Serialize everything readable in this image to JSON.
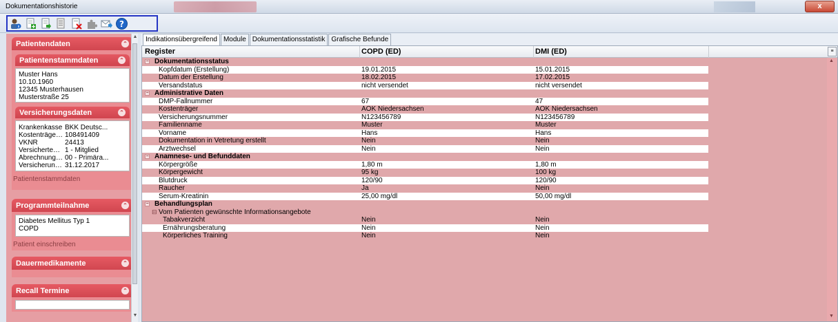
{
  "window": {
    "title": "Dokumentationshistorie",
    "close_glyph": "x"
  },
  "toolbar": {
    "icons": [
      "patient-info-icon",
      "document-add-icon",
      "document-export-icon",
      "document-list-icon",
      "document-delete-icon",
      "puzzle-icon",
      "mail-send-icon",
      "help-icon"
    ]
  },
  "sidebar": {
    "patientendaten": {
      "title": "Patientendaten",
      "stamm": {
        "title": "Patientenstammdaten",
        "lines": [
          "Muster Hans",
          "10.10.1960",
          "12345 Musterhausen",
          "Musterstraße 25"
        ]
      },
      "versicherung": {
        "title": "Versicherungsdaten",
        "rows": [
          {
            "k": "Krankenkasse",
            "v": "BKK Deutsc..."
          },
          {
            "k": "Kostenträgerk...",
            "v": "108491409"
          },
          {
            "k": "VKNR",
            "v": "24413"
          },
          {
            "k": "Versichertenart",
            "v": "1 - Mitglied"
          },
          {
            "k": "Abrechnungsb...",
            "v": "00 - Primära..."
          },
          {
            "k": "Versicherungs...",
            "v": "31.12.2017"
          }
        ]
      },
      "link": "Patientenstammdaten"
    },
    "programm": {
      "title": "Programmteilnahme",
      "lines": [
        "Diabetes Mellitus Typ 1",
        "COPD"
      ],
      "link": "Patient einschreiben"
    },
    "dauer": {
      "title": "Dauermedikamente"
    },
    "recall": {
      "title": "Recall Termine"
    }
  },
  "tabs": [
    "Indikationsübergreifend",
    "Module",
    "Dokumentationsstatistik",
    "Grafische Befunde"
  ],
  "grid": {
    "headers": [
      "Register",
      "COPD (ED)",
      "DMI (ED)"
    ],
    "rows": [
      {
        "type": "group",
        "label": "Dokumentationsstatus"
      },
      {
        "type": "white",
        "label": "Kopfdatum (Erstellung)",
        "c1": "19.01.2015",
        "c2": "15.01.2015"
      },
      {
        "type": "pink",
        "label": "Datum der Erstellung",
        "c1": "18.02.2015",
        "c2": "17.02.2015"
      },
      {
        "type": "white",
        "label": "Versandstatus",
        "c1": "nicht versendet",
        "c2": "nicht versendet"
      },
      {
        "type": "group",
        "label": "Administrative Daten"
      },
      {
        "type": "white",
        "label": "DMP-Fallnummer",
        "c1": "67",
        "c2": "47"
      },
      {
        "type": "pink",
        "label": "Kostenträger",
        "c1": "AOK Niedersachsen",
        "c2": "AOK Niedersachsen"
      },
      {
        "type": "white",
        "label": "Versicherungsnummer",
        "c1": "N123456789",
        "c2": "N123456789"
      },
      {
        "type": "pink",
        "label": "Familienname",
        "c1": "Muster",
        "c2": "Muster"
      },
      {
        "type": "white",
        "label": "Vorname",
        "c1": "Hans",
        "c2": "Hans"
      },
      {
        "type": "pink",
        "label": "Dokumentation in Vetretung erstellt",
        "c1": "Nein",
        "c2": "Nein"
      },
      {
        "type": "white",
        "label": "Arztwechsel",
        "c1": "Nein",
        "c2": "Nein"
      },
      {
        "type": "group",
        "label": "Anamnese- und Befunddaten"
      },
      {
        "type": "white",
        "label": "Körpergröße",
        "c1": "1,80 m",
        "c2": "1,80 m"
      },
      {
        "type": "pink",
        "label": "Körpergewicht",
        "c1": "95 kg",
        "c2": "100 kg"
      },
      {
        "type": "white",
        "label": "Blutdruck",
        "c1": "120/90",
        "c2": "120/90"
      },
      {
        "type": "pink",
        "label": "Raucher",
        "c1": "Ja",
        "c2": "Nein"
      },
      {
        "type": "white",
        "label": "Serum-Kreatinin",
        "c1": "25,00 mg/dl",
        "c2": "50,00 mg/dl"
      },
      {
        "type": "group",
        "label": "Behandlungsplan"
      },
      {
        "type": "subgroup",
        "label": "Vom Patienten gewünschte Informationsangebote"
      },
      {
        "type": "pink sub",
        "label": "Tabakverzicht",
        "c1": "Nein",
        "c2": "Nein"
      },
      {
        "type": "white sub",
        "label": "Ernährungsberatung",
        "c1": "Nein",
        "c2": "Nein"
      },
      {
        "type": "pink sub",
        "label": "Körperliches Training",
        "c1": "Nein",
        "c2": "Nein"
      }
    ]
  }
}
